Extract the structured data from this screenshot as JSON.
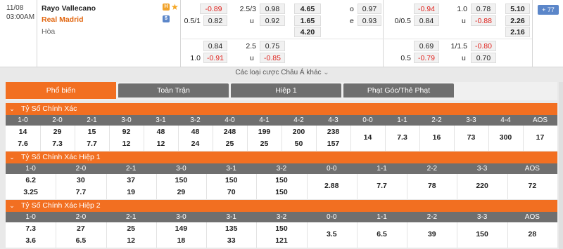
{
  "match": {
    "date": "11/08",
    "time": "03:00AM",
    "home": "Rayo Vallecano",
    "away": "Real Madrid",
    "draw": "Hòa",
    "home_badge": "H",
    "away_badge": "$",
    "home_color": "#222222",
    "away_color": "#e2660f"
  },
  "odds": {
    "r1": {
      "hdp_home": "-0.89",
      "line": "2.5/3",
      "ou_over": "0.98",
      "x12_home": "4.65",
      "o_label": "o",
      "o_val": "0.97",
      "fh_home": "-0.94",
      "fh_line": "1.0",
      "fh_over": "0.78",
      "fh_x12": "5.10"
    },
    "r2": {
      "hdp_line": "0.5/1",
      "hdp_away": "0.82",
      "u_label": "u",
      "ou_under": "0.92",
      "x12_away": "1.65",
      "e_label": "e",
      "e_val": "0.93",
      "fh_hdp_line": "0/0.5",
      "fh_away": "0.84",
      "fh_u": "u",
      "fh_under": "-0.88",
      "fh_x12": "2.26"
    },
    "r3": {
      "x12_draw": "4.20",
      "fh_x12": "2.16"
    },
    "r4": {
      "hdp_home": "0.84",
      "line": "2.5",
      "ou_over": "0.75",
      "fh_home": "0.69",
      "fh_line": "1/1.5",
      "fh_over": "-0.80"
    },
    "r5": {
      "hdp_line": "1.0",
      "hdp_away": "-0.91",
      "u_label": "u",
      "ou_under": "-0.85",
      "fh_hdp_line": "0.5",
      "fh_away": "-0.79",
      "fh_u": "u",
      "fh_under": "0.70"
    }
  },
  "more_bets": "Các loại cược Châu Á khác",
  "more_button": "+ 77",
  "tabs": [
    "Phổ biến",
    "Toàn Trận",
    "Hiệp 1",
    "Phạt Góc/Thẻ Phạt"
  ],
  "sections": [
    {
      "title": "Tỷ Số Chính Xác",
      "headers": [
        "1-0",
        "2-0",
        "2-1",
        "3-0",
        "3-1",
        "3-2",
        "4-0",
        "4-1",
        "4-2",
        "4-3",
        "0-0",
        "1-1",
        "2-2",
        "3-3",
        "4-4",
        "AOS"
      ],
      "home": [
        "14",
        "29",
        "15",
        "92",
        "48",
        "48",
        "248",
        "199",
        "200",
        "238"
      ],
      "away": [
        "7.6",
        "7.3",
        "7.7",
        "12",
        "12",
        "24",
        "25",
        "25",
        "50",
        "157"
      ],
      "single": [
        "14",
        "7.3",
        "16",
        "73",
        "300",
        "17"
      ]
    },
    {
      "title": "Tỷ Số Chính Xác Hiệp 1",
      "headers": [
        "1-0",
        "2-0",
        "2-1",
        "3-0",
        "3-1",
        "3-2",
        "0-0",
        "1-1",
        "2-2",
        "3-3",
        "AOS"
      ],
      "home": [
        "6.2",
        "30",
        "37",
        "150",
        "150",
        "150"
      ],
      "away": [
        "3.25",
        "7.7",
        "19",
        "29",
        "70",
        "150"
      ],
      "single": [
        "2.88",
        "7.7",
        "78",
        "220",
        "72"
      ]
    },
    {
      "title": "Tỷ Số Chính Xác Hiệp 2",
      "headers": [
        "1-0",
        "2-0",
        "2-1",
        "3-0",
        "3-1",
        "3-2",
        "0-0",
        "1-1",
        "2-2",
        "3-3",
        "AOS"
      ],
      "home": [
        "7.3",
        "27",
        "25",
        "149",
        "135",
        "150"
      ],
      "away": [
        "3.6",
        "6.5",
        "12",
        "18",
        "33",
        "121"
      ],
      "single": [
        "3.5",
        "6.5",
        "39",
        "150",
        "28"
      ]
    }
  ]
}
